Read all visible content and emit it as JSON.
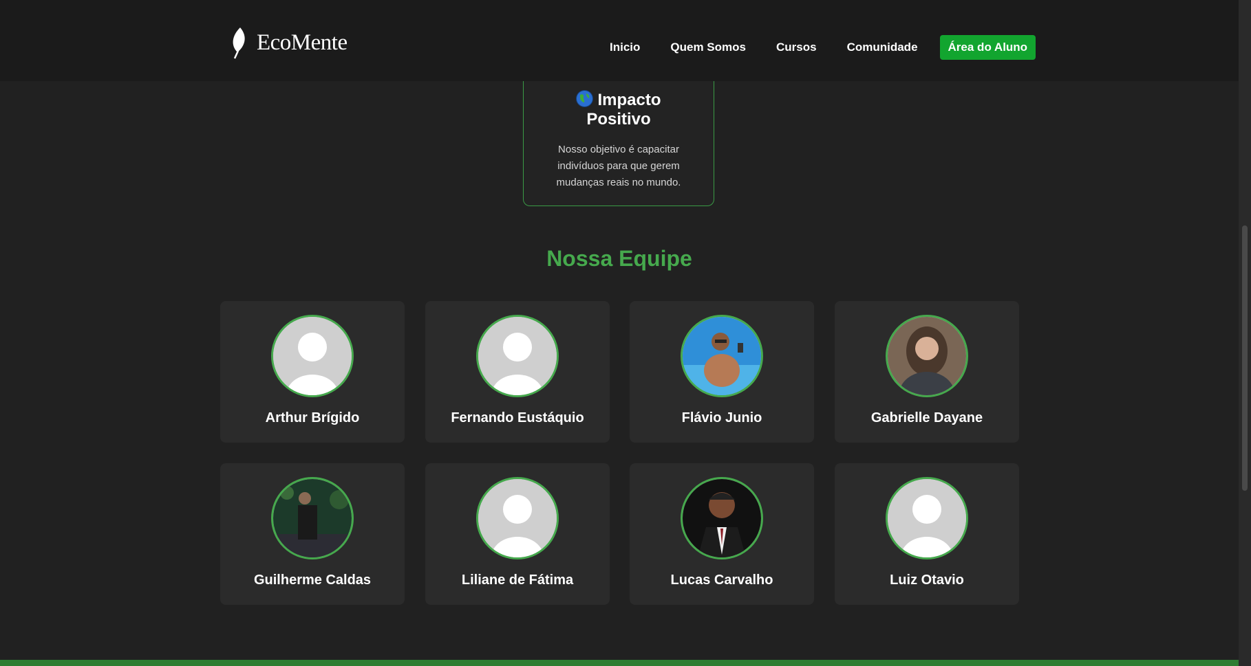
{
  "brand": {
    "name": "EcoMente",
    "logo_icon": "leaf-icon"
  },
  "nav": {
    "items": [
      "Inicio",
      "Quem Somos",
      "Cursos",
      "Comunidade"
    ],
    "cta": "Área do Aluno"
  },
  "impact": {
    "icon": "globe-icon",
    "title": "Impacto Positivo",
    "text": "Nosso objetivo é capacitar indivíduos para que gerem mudanças reais no mundo."
  },
  "team": {
    "title": "Nossa Equipe",
    "members": [
      {
        "name": "Arthur Brígido",
        "photo": "placeholder"
      },
      {
        "name": "Fernando Eustáquio",
        "photo": "placeholder"
      },
      {
        "name": "Flávio Junio",
        "photo": "photo"
      },
      {
        "name": "Gabrielle Dayane",
        "photo": "photo"
      },
      {
        "name": "Guilherme Caldas",
        "photo": "photo"
      },
      {
        "name": "Liliane de Fátima",
        "photo": "placeholder"
      },
      {
        "name": "Lucas Carvalho",
        "photo": "photo"
      },
      {
        "name": "Luiz Otavio",
        "photo": "placeholder"
      }
    ]
  },
  "colors": {
    "background": "#212121",
    "header": "#1b1b1b",
    "accent": "#46a94d",
    "cta": "#12a52f",
    "card": "#2b2b2b"
  }
}
